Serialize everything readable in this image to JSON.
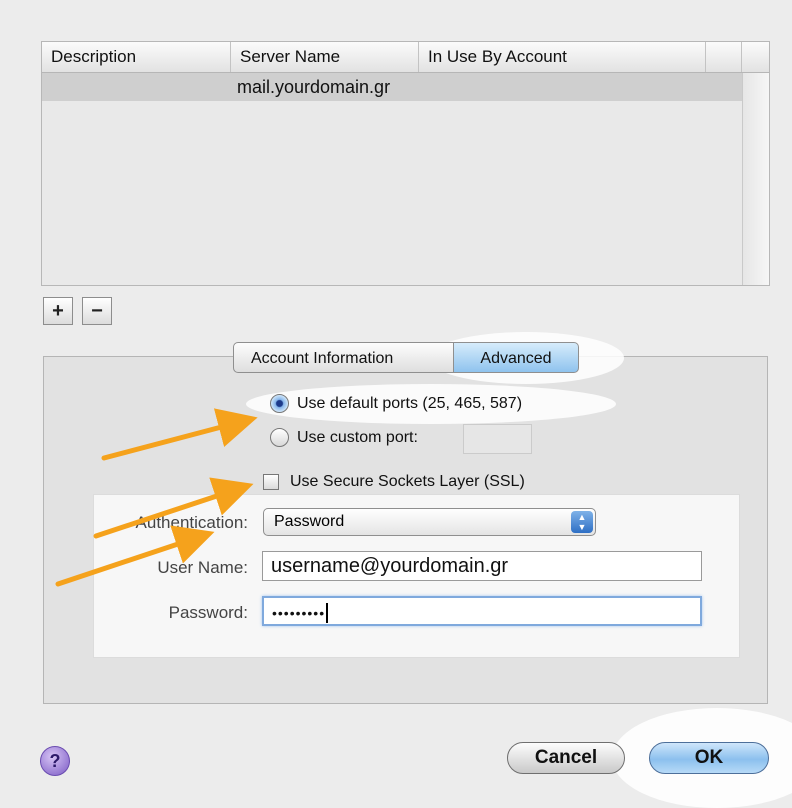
{
  "table": {
    "columns": [
      "Description",
      "Server Name",
      "In Use By Account"
    ],
    "rows": [
      {
        "description": "",
        "server_name": "mail.yourdomain.gr",
        "in_use_by": ""
      }
    ]
  },
  "list_buttons": {
    "add": "+",
    "remove": "−"
  },
  "tabs": [
    {
      "label": "Account Information",
      "selected": false
    },
    {
      "label": "Advanced",
      "selected": true
    }
  ],
  "ports": {
    "default_label": "Use default ports (25, 465, 587)",
    "custom_label": "Use custom port:",
    "custom_value": "",
    "selected": "default"
  },
  "ssl": {
    "label": "Use Secure Sockets Layer (SSL)",
    "checked": false
  },
  "auth": {
    "auth_label": "Authentication:",
    "auth_value": "Password",
    "user_label": "User Name:",
    "user_value": "username@yourdomain.gr",
    "password_label": "Password:",
    "password_value": "•••••••••"
  },
  "buttons": {
    "help": "?",
    "cancel": "Cancel",
    "ok": "OK"
  },
  "colors": {
    "annotation_arrow": "#f5a21c",
    "accent_blue": "#8cc0ee"
  }
}
